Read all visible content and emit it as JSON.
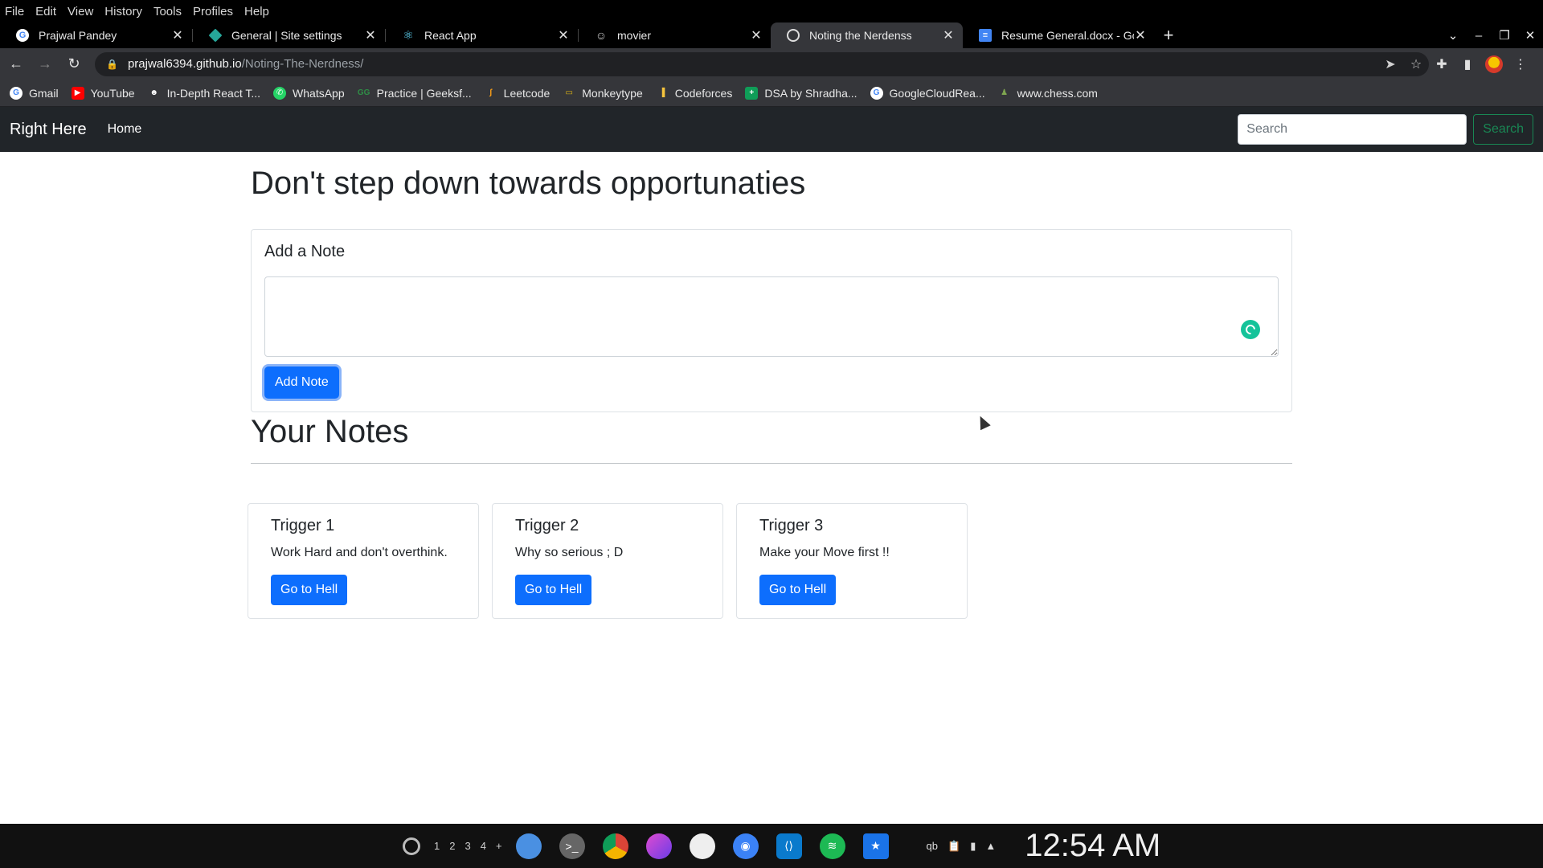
{
  "menu": [
    "File",
    "Edit",
    "View",
    "History",
    "Tools",
    "Profiles",
    "Help"
  ],
  "tabs": [
    {
      "title": "Prajwal Pandey",
      "icon": "google-icon",
      "active": false
    },
    {
      "title": "General | Site settings",
      "icon": "diamond-icon",
      "active": false
    },
    {
      "title": "React App",
      "icon": "react-icon",
      "active": false
    },
    {
      "title": "movier",
      "icon": "movier-icon",
      "active": false
    },
    {
      "title": "Noting the Nerdenss",
      "icon": "globe-icon",
      "active": true
    },
    {
      "title": "Resume General.docx - Goog",
      "icon": "docs-icon",
      "active": false
    }
  ],
  "address": {
    "host": "prajwal6394.github.io",
    "path": "/Noting-The-Nerdness/"
  },
  "bookmarks": [
    {
      "label": "Gmail",
      "icon": "google-icon"
    },
    {
      "label": "YouTube",
      "icon": "youtube-icon"
    },
    {
      "label": "In-Depth React T...",
      "icon": "user-icon"
    },
    {
      "label": "WhatsApp",
      "icon": "whatsapp-icon"
    },
    {
      "label": "Practice | Geeksf...",
      "icon": "gfg-icon"
    },
    {
      "label": "Leetcode",
      "icon": "leetcode-icon"
    },
    {
      "label": "Monkeytype",
      "icon": "monkeytype-icon"
    },
    {
      "label": "Codeforces",
      "icon": "codeforces-icon"
    },
    {
      "label": "DSA by Shradha...",
      "icon": "sheets-icon"
    },
    {
      "label": "GoogleCloudRea...",
      "icon": "google-icon"
    },
    {
      "label": "www.chess.com",
      "icon": "chess-icon"
    }
  ],
  "navbar": {
    "brand": "Right Here",
    "home": "Home",
    "search_placeholder": "Search",
    "search_button": "Search"
  },
  "page": {
    "title": "Don't step down towards opportunaties",
    "add_note_title": "Add a Note",
    "add_note_button": "Add Note",
    "notes_heading": "Your Notes"
  },
  "notes": [
    {
      "title": "Trigger 1",
      "text": "Work Hard and don't overthink.",
      "button": "Go to Hell"
    },
    {
      "title": "Trigger 2",
      "text": "Why so serious ; D",
      "button": "Go to Hell"
    },
    {
      "title": "Trigger 3",
      "text": "Make your Move first !!",
      "button": "Go to Hell"
    }
  ],
  "taskbar": {
    "workspaces": [
      "1",
      "2",
      "3",
      "4",
      "+"
    ],
    "clock": "12:54 AM"
  },
  "colors": {
    "navbar": "#212529",
    "primary": "#0d6efd",
    "success": "#198754",
    "grammarly": "#15c39a"
  }
}
